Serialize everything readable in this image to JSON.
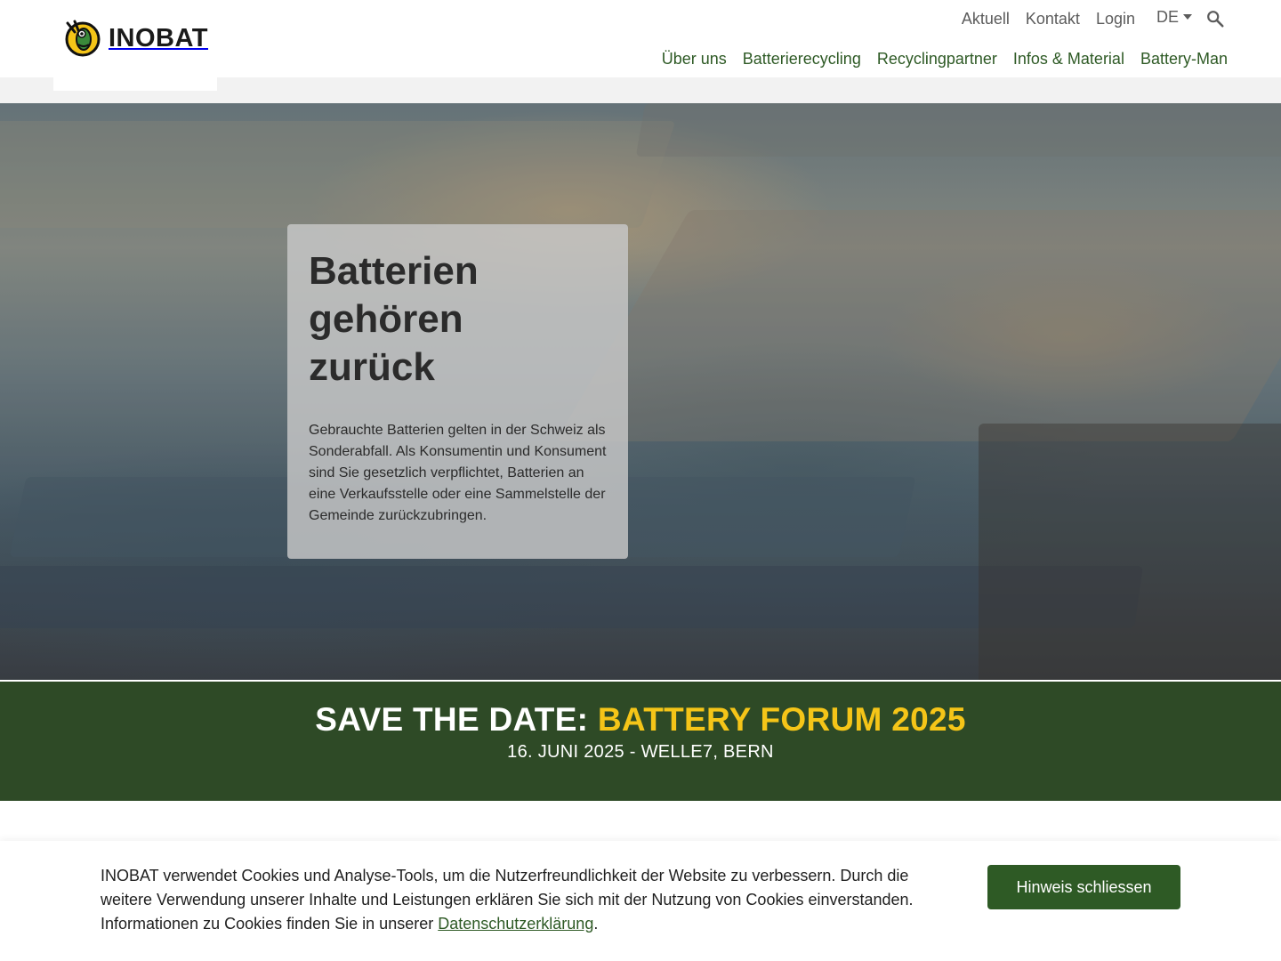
{
  "header": {
    "logo_text": "INOBAT",
    "top_links": [
      "Aktuell",
      "Kontakt",
      "Login"
    ],
    "language": "DE",
    "nav": [
      "Über uns",
      "Batterierecycling",
      "Recyclingpartner",
      "Infos & Material",
      "Battery-Man"
    ]
  },
  "hero": {
    "title": "Batterien gehören zurück",
    "text": "Gebrauchte Batterien gelten in der Schweiz als Sonderabfall. Als Konsumentin und Konsument sind Sie gesetzlich verpflichtet, Batterien an eine Verkaufsstelle oder eine Sammelstelle der Gemeinde zurückzubringen."
  },
  "banner": {
    "title_prefix": "SAVE THE DATE:",
    "title_highlight": "BATTERY FORUM 2025",
    "subtitle": "16. JUNI 2025 - WELLE7, BERN"
  },
  "cookie": {
    "text": "INOBAT verwendet Cookies und Analyse-Tools, um die Nutzerfreundlichkeit der Website zu verbessern. Durch die weitere Verwendung unserer Inhalte und Leistungen erklären Sie sich mit der Nutzung von Cookies einverstanden. Informationen zu Cookies finden Sie in unserer",
    "link_text": "Datenschutzerklärung",
    "suffix": ".",
    "button": "Hinweis schliessen"
  },
  "colors": {
    "brand_green": "#2e5a25",
    "banner_green": "#2e4a26",
    "highlight_yellow": "#f5c518"
  }
}
